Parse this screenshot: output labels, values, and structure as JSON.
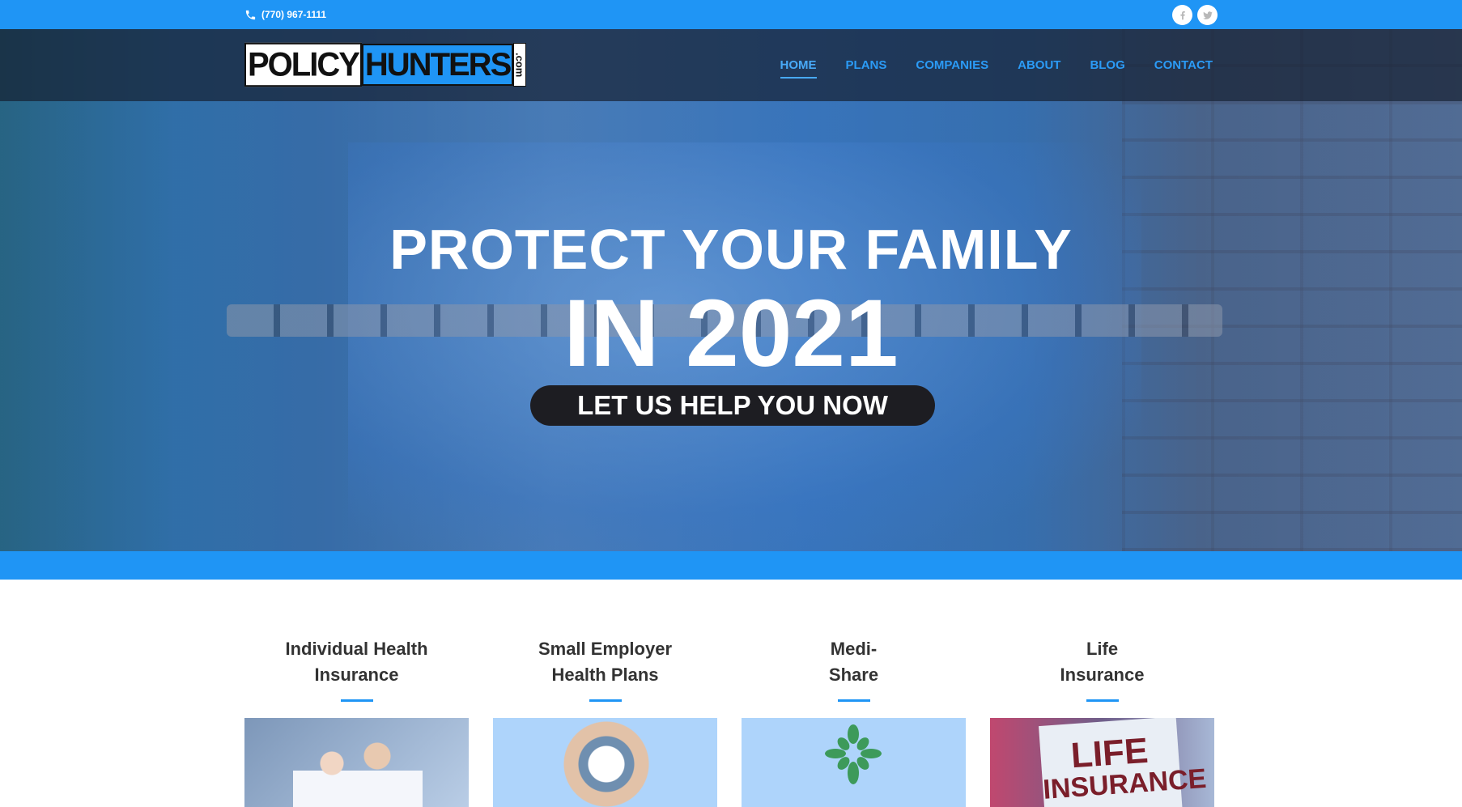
{
  "topbar": {
    "phone": "(770) 967-1111",
    "phone_icon": "phone-icon",
    "social": [
      "facebook-icon",
      "twitter-icon"
    ]
  },
  "logo": {
    "part1": "POLICY",
    "part2": "HUNTERS",
    "part3": ".com"
  },
  "nav": {
    "items": [
      {
        "label": "HOME",
        "active": true
      },
      {
        "label": "PLANS",
        "active": false
      },
      {
        "label": "COMPANIES",
        "active": false
      },
      {
        "label": "ABOUT",
        "active": false
      },
      {
        "label": "BLOG",
        "active": false
      },
      {
        "label": "CONTACT",
        "active": false
      }
    ]
  },
  "hero": {
    "line1": "PROTECT YOUR FAMILY",
    "line2": "IN 2021",
    "cta": "LET US HELP YOU NOW"
  },
  "plans": [
    {
      "line1": "Individual Health",
      "line2": "Insurance"
    },
    {
      "line1": "Small Employer",
      "line2": "Health Plans"
    },
    {
      "line1": "Medi-",
      "line2": "Share"
    },
    {
      "line1": "Life",
      "line2": "Insurance"
    }
  ],
  "colors": {
    "brand": "#1f95f5",
    "nav_text": "#2b9bf6",
    "cta_bg": "#1d1d22"
  }
}
